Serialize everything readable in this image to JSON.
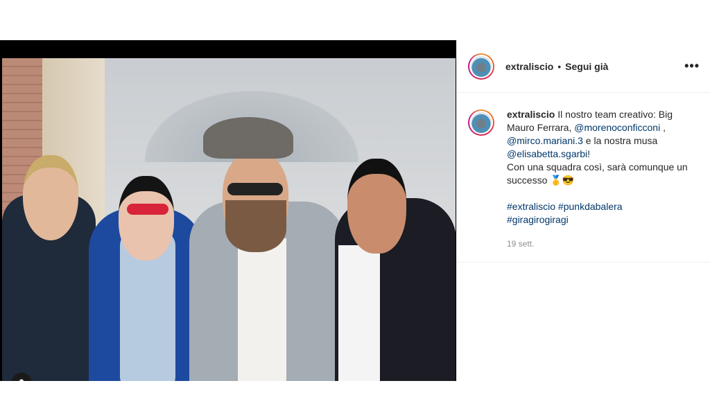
{
  "post": {
    "username": "extraliscio",
    "follow_status": "Segui già",
    "more_icon": "•••",
    "caption": {
      "line1": "Il nostro team creativo: Big Mauro Ferrara,",
      "mention1": "@morenoconficconi",
      "sep1": " ,",
      "mention2": "@mirco.mariani.3",
      "text2": " e la nostra musa ",
      "mention3": "@elisabetta.sgarbi",
      "excl": "!",
      "line2": "Con una squadra così, sarà comunque un successo",
      "emojis": "🥇😎",
      "hashtag1": "#extraliscio",
      "hashtag2": "#punkdabalera",
      "hashtag3": "#giragirogiragi"
    },
    "timestamp": "19 sett."
  },
  "icons": {
    "user_tag": "person-icon",
    "more": "more-options-icon"
  },
  "colors": {
    "link": "#00376b",
    "muted": "#8e8e8e",
    "text": "#262626"
  }
}
